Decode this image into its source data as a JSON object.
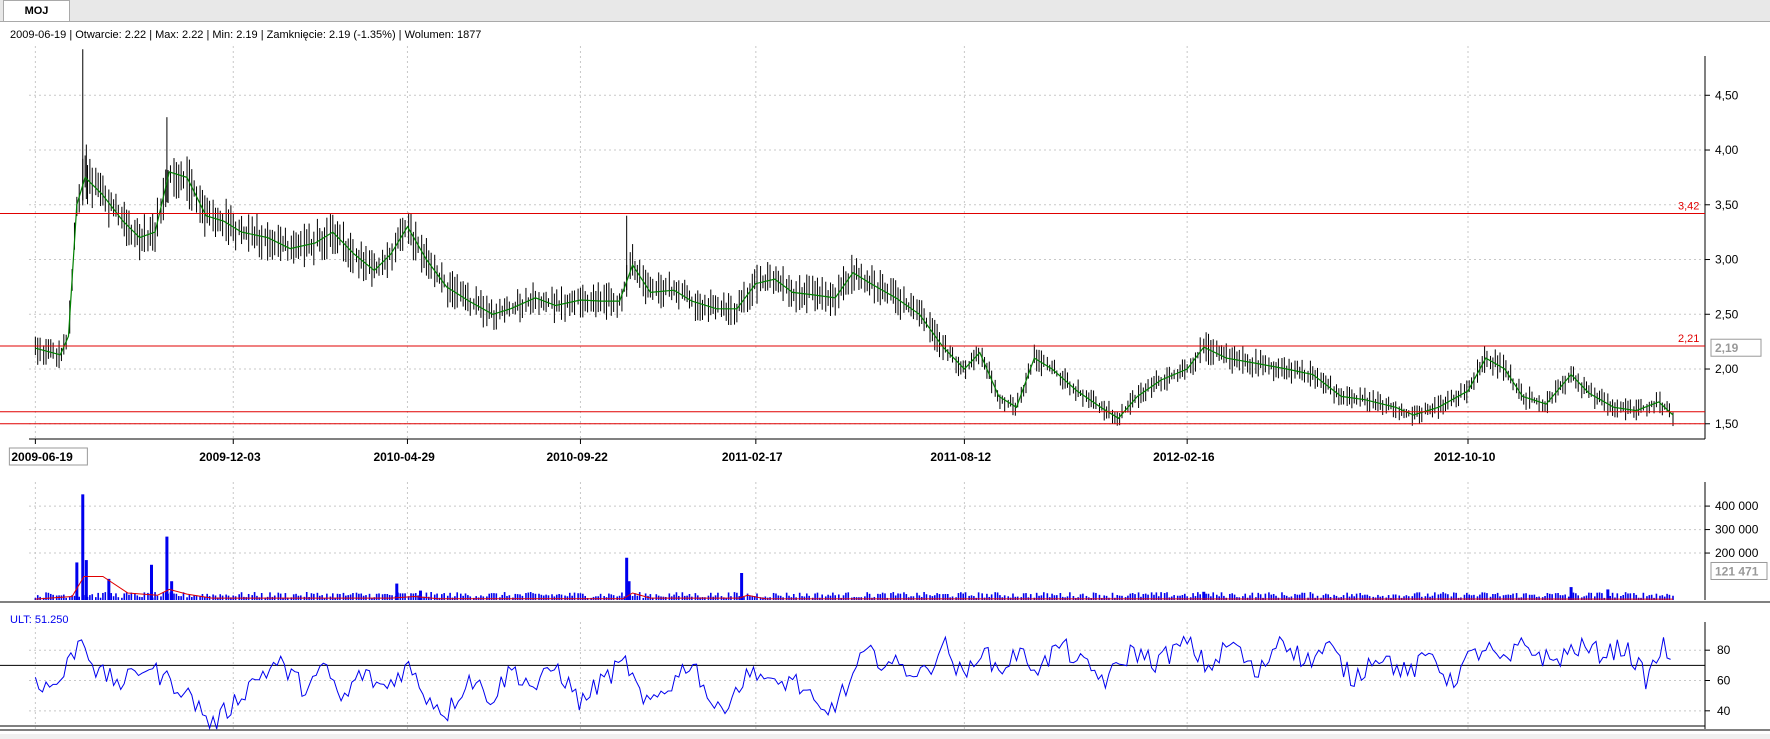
{
  "tab": {
    "label": "MOJ"
  },
  "info_bar": {
    "text": "2009-06-19 | Otwarcie: 2.22 | Max: 2.22 | Min: 2.19 | Zamknięcie: 2.19 (-1.35%)  | Wolumen: 1877"
  },
  "colors": {
    "candle": "#000000",
    "moving_average": "#008000",
    "level_line": "#e00000",
    "volume_bar": "#0000ee",
    "volume_average": "#e00000",
    "indicator_line": "#0000ee",
    "grid": "#c8c8c8"
  },
  "chart_data": [
    {
      "type": "line",
      "name": "price",
      "y_ticks": [
        "1,50",
        "2,00",
        "2,50",
        "3,00",
        "3,50",
        "4,00",
        "4,50"
      ],
      "y_tick_values": [
        1.5,
        2.0,
        2.5,
        3.0,
        3.5,
        4.0,
        4.5
      ],
      "ylim": [
        1.37,
        4.95
      ],
      "x_date_labels": [
        "2009-06-19",
        "2009-12-03",
        "2010-04-29",
        "2010-09-22",
        "2011-02-17",
        "2011-08-12",
        "2012-02-16",
        "2012-10-10"
      ],
      "x_date_values": [
        "2009-06-19",
        "2009-12-03",
        "2010-04-29",
        "2010-09-22",
        "2011-02-17",
        "2011-08-12",
        "2012-02-16",
        "2012-10-10"
      ],
      "xlim": [
        "2009-06-17",
        "2013-04-28"
      ],
      "current_value": "2,19",
      "levels": [
        {
          "value": 3.42,
          "label": "3,42"
        },
        {
          "value": 2.21,
          "label": "2,21"
        },
        {
          "value": 1.61
        },
        {
          "value": 1.5
        }
      ],
      "close_points": [
        [
          "2009-06-19",
          2.19
        ],
        [
          "2009-07-10",
          2.13
        ],
        [
          "2009-07-17",
          2.3
        ],
        [
          "2009-07-24",
          3.5
        ],
        [
          "2009-07-31",
          3.75
        ],
        [
          "2009-08-14",
          3.6
        ],
        [
          "2009-09-01",
          3.35
        ],
        [
          "2009-09-15",
          3.2
        ],
        [
          "2009-09-28",
          3.25
        ],
        [
          "2009-10-10",
          3.8
        ],
        [
          "2009-10-25",
          3.75
        ],
        [
          "2009-11-10",
          3.4
        ],
        [
          "2009-11-25",
          3.35
        ],
        [
          "2009-12-10",
          3.25
        ],
        [
          "2010-01-01",
          3.2
        ],
        [
          "2010-01-20",
          3.1
        ],
        [
          "2010-02-10",
          3.15
        ],
        [
          "2010-02-25",
          3.25
        ],
        [
          "2010-03-15",
          3.05
        ],
        [
          "2010-04-01",
          2.9
        ],
        [
          "2010-04-15",
          3.05
        ],
        [
          "2010-04-29",
          3.3
        ],
        [
          "2010-05-15",
          3.0
        ],
        [
          "2010-06-01",
          2.75
        ],
        [
          "2010-06-20",
          2.62
        ],
        [
          "2010-07-10",
          2.5
        ],
        [
          "2010-07-25",
          2.55
        ],
        [
          "2010-08-15",
          2.65
        ],
        [
          "2010-09-01",
          2.58
        ],
        [
          "2010-09-22",
          2.63
        ],
        [
          "2010-10-10",
          2.62
        ],
        [
          "2010-10-25",
          2.62
        ],
        [
          "2010-11-05",
          2.95
        ],
        [
          "2010-11-20",
          2.7
        ],
        [
          "2010-12-10",
          2.72
        ],
        [
          "2010-12-25",
          2.62
        ],
        [
          "2011-01-15",
          2.55
        ],
        [
          "2011-02-01",
          2.55
        ],
        [
          "2011-02-17",
          2.78
        ],
        [
          "2011-03-05",
          2.82
        ],
        [
          "2011-03-20",
          2.7
        ],
        [
          "2011-04-05",
          2.68
        ],
        [
          "2011-04-25",
          2.65
        ],
        [
          "2011-05-10",
          2.88
        ],
        [
          "2011-05-25",
          2.78
        ],
        [
          "2011-06-15",
          2.65
        ],
        [
          "2011-07-05",
          2.5
        ],
        [
          "2011-07-25",
          2.2
        ],
        [
          "2011-08-12",
          2.0
        ],
        [
          "2011-08-25",
          2.15
        ],
        [
          "2011-09-10",
          1.75
        ],
        [
          "2011-09-25",
          1.65
        ],
        [
          "2011-10-10",
          2.1
        ],
        [
          "2011-10-25",
          2.0
        ],
        [
          "2011-11-15",
          1.8
        ],
        [
          "2011-12-05",
          1.65
        ],
        [
          "2011-12-20",
          1.55
        ],
        [
          "2012-01-05",
          1.75
        ],
        [
          "2012-01-25",
          1.9
        ],
        [
          "2012-02-16",
          2.0
        ],
        [
          "2012-03-01",
          2.2
        ],
        [
          "2012-03-20",
          2.1
        ],
        [
          "2012-04-15",
          2.05
        ],
        [
          "2012-05-10",
          2.0
        ],
        [
          "2012-06-01",
          1.95
        ],
        [
          "2012-06-25",
          1.75
        ],
        [
          "2012-07-15",
          1.72
        ],
        [
          "2012-08-10",
          1.65
        ],
        [
          "2012-08-25",
          1.58
        ],
        [
          "2012-09-15",
          1.65
        ],
        [
          "2012-10-10",
          1.8
        ],
        [
          "2012-10-25",
          2.1
        ],
        [
          "2012-11-10",
          2.0
        ],
        [
          "2012-11-25",
          1.75
        ],
        [
          "2012-12-15",
          1.68
        ],
        [
          "2013-01-05",
          1.95
        ],
        [
          "2013-01-20",
          1.78
        ],
        [
          "2013-02-10",
          1.65
        ],
        [
          "2013-03-01",
          1.62
        ],
        [
          "2013-03-20",
          1.7
        ],
        [
          "2013-04-01",
          1.58
        ]
      ],
      "spikes": [
        [
          "2009-07-29",
          4.92
        ],
        [
          "2009-08-01",
          4.05
        ],
        [
          "2009-10-08",
          4.3
        ],
        [
          "2010-10-31",
          3.4
        ]
      ]
    },
    {
      "type": "bar",
      "name": "volume",
      "y_ticks": [
        "200 000",
        "300 000",
        "400 000"
      ],
      "y_tick_values": [
        200000,
        300000,
        400000
      ],
      "ylim": [
        0,
        460000
      ],
      "current_value": "121 471",
      "spikes": [
        [
          "2009-07-24",
          160000
        ],
        [
          "2009-07-29",
          450000
        ],
        [
          "2009-08-01",
          170000
        ],
        [
          "2009-08-20",
          90000
        ],
        [
          "2009-09-25",
          150000
        ],
        [
          "2009-10-08",
          270000
        ],
        [
          "2009-10-12",
          80000
        ],
        [
          "2010-04-20",
          70000
        ],
        [
          "2010-05-10",
          40000
        ],
        [
          "2010-10-31",
          180000
        ],
        [
          "2010-11-02",
          80000
        ],
        [
          "2011-02-05",
          115000
        ],
        [
          "2012-03-01",
          35000
        ],
        [
          "2013-01-05",
          55000
        ],
        [
          "2013-02-05",
          45000
        ]
      ]
    },
    {
      "type": "line",
      "name": "ULT",
      "label": "ULT: 51.250",
      "y_ticks": [
        "40",
        "60",
        "80"
      ],
      "y_tick_values": [
        40,
        60,
        80
      ],
      "ylim": [
        28,
        92
      ],
      "levels": [
        70,
        30
      ],
      "points": [
        [
          "2009-06-19",
          62
        ],
        [
          "2009-06-29",
          55
        ],
        [
          "2009-07-10",
          60
        ],
        [
          "2009-07-22",
          80
        ],
        [
          "2009-07-29",
          89
        ],
        [
          "2009-08-10",
          65
        ],
        [
          "2009-09-01",
          58
        ],
        [
          "2009-09-20",
          70
        ],
        [
          "2009-10-05",
          62
        ],
        [
          "2009-10-20",
          55
        ],
        [
          "2009-11-05",
          42
        ],
        [
          "2009-11-15",
          30
        ],
        [
          "2009-12-03",
          45
        ],
        [
          "2009-12-20",
          60
        ],
        [
          "2010-01-10",
          72
        ],
        [
          "2010-02-01",
          55
        ],
        [
          "2010-02-20",
          68
        ],
        [
          "2010-03-05",
          45
        ],
        [
          "2010-03-20",
          65
        ],
        [
          "2010-04-10",
          55
        ],
        [
          "2010-04-29",
          70
        ],
        [
          "2010-05-15",
          50
        ],
        [
          "2010-06-01",
          38
        ],
        [
          "2010-06-20",
          62
        ],
        [
          "2010-07-10",
          48
        ],
        [
          "2010-07-25",
          68
        ],
        [
          "2010-08-15",
          55
        ],
        [
          "2010-09-01",
          70
        ],
        [
          "2010-09-22",
          45
        ],
        [
          "2010-10-10",
          60
        ],
        [
          "2010-10-31",
          72
        ],
        [
          "2010-11-15",
          42
        ],
        [
          "2010-12-10",
          60
        ],
        [
          "2010-12-25",
          74
        ],
        [
          "2011-01-15",
          38
        ],
        [
          "2011-02-01",
          55
        ],
        [
          "2011-02-17",
          68
        ],
        [
          "2011-03-05",
          55
        ],
        [
          "2011-03-20",
          62
        ],
        [
          "2011-04-15",
          36
        ],
        [
          "2011-05-05",
          55
        ],
        [
          "2011-05-20",
          78
        ],
        [
          "2011-06-15",
          70
        ],
        [
          "2011-07-10",
          64
        ],
        [
          "2011-07-25",
          85
        ],
        [
          "2011-08-12",
          60
        ],
        [
          "2011-08-25",
          82
        ],
        [
          "2011-09-10",
          66
        ],
        [
          "2011-09-25",
          78
        ],
        [
          "2011-10-15",
          68
        ],
        [
          "2011-11-01",
          84
        ],
        [
          "2011-11-20",
          70
        ],
        [
          "2011-12-10",
          60
        ],
        [
          "2012-01-01",
          80
        ],
        [
          "2012-01-20",
          72
        ],
        [
          "2012-02-16",
          85
        ],
        [
          "2012-03-05",
          68
        ],
        [
          "2012-03-25",
          86
        ],
        [
          "2012-04-15",
          62
        ],
        [
          "2012-05-05",
          90
        ],
        [
          "2012-05-25",
          72
        ],
        [
          "2012-06-15",
          82
        ],
        [
          "2012-07-05",
          60
        ],
        [
          "2012-07-25",
          78
        ],
        [
          "2012-08-20",
          64
        ],
        [
          "2012-09-10",
          78
        ],
        [
          "2012-09-25",
          58
        ],
        [
          "2012-10-10",
          74
        ],
        [
          "2012-10-25",
          82
        ],
        [
          "2012-11-10",
          70
        ],
        [
          "2012-11-25",
          84
        ],
        [
          "2012-12-20",
          72
        ],
        [
          "2013-01-10",
          82
        ],
        [
          "2013-02-01",
          78
        ],
        [
          "2013-02-20",
          82
        ],
        [
          "2013-03-10",
          60
        ],
        [
          "2013-03-25",
          86
        ],
        [
          "2013-04-01",
          60
        ]
      ]
    }
  ]
}
